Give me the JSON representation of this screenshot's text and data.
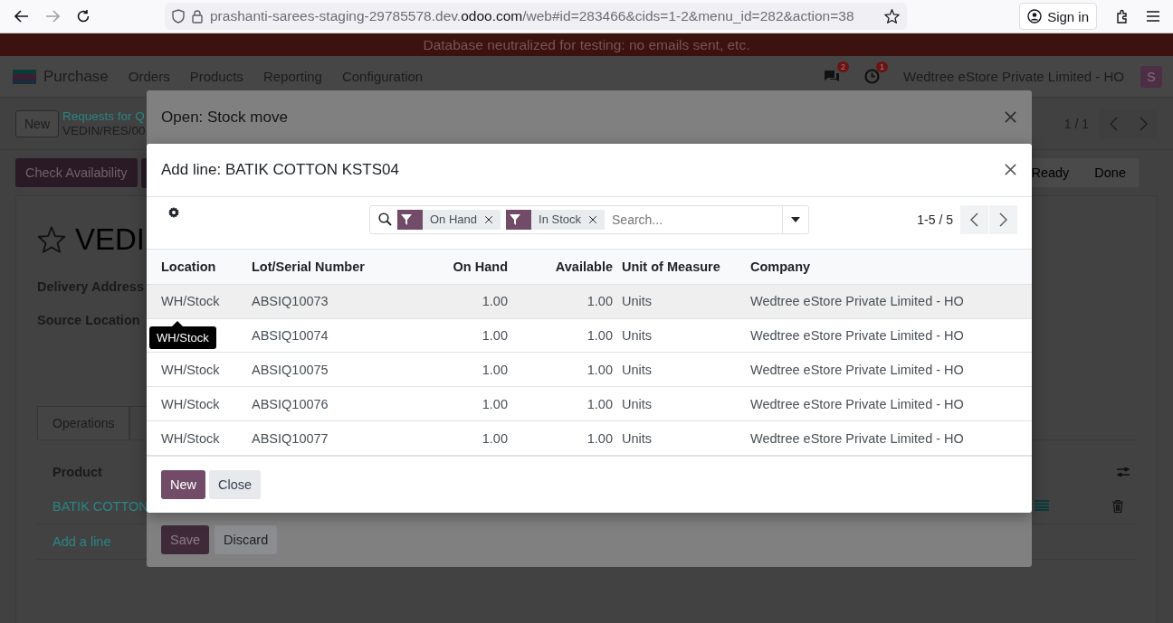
{
  "browser": {
    "url_prefix": "prashanti-sarees-staging-29785578.dev.",
    "url_domain": "odoo.com",
    "url_path": "/web#id=283466&cids=1-2&menu_id=282&action=38",
    "sign_in": "Sign in"
  },
  "banner": "Database neutralized for testing: no emails sent, etc.",
  "navbar": {
    "app": "Purchase",
    "menu": [
      "Orders",
      "Products",
      "Reporting",
      "Configuration"
    ],
    "messages_badge": "2",
    "activities_badge": "1",
    "company": "Wedtree eStore Private Limited - HO",
    "avatar": "S"
  },
  "control_panel": {
    "new": "New",
    "breadcrumb": "Requests for Q",
    "record": "VEDIN/RES/00",
    "pager": "1 / 1"
  },
  "statusbar": {
    "button": "Check Availability",
    "steps": [
      "Ready",
      "Done"
    ]
  },
  "form": {
    "title": "VEDI",
    "fields": [
      "Delivery Address",
      "Source Location"
    ],
    "tabs": [
      {
        "label": "Operations",
        "selected": true
      }
    ],
    "product_header": "Product",
    "line": "BATIK COTTON",
    "add_line": "Add a line"
  },
  "dialog_back": {
    "title": "Open: Stock move",
    "buttons": [
      {
        "label": "Save",
        "kind": "primary"
      },
      {
        "label": "Discard",
        "kind": "secondary"
      }
    ]
  },
  "dialog": {
    "title": "Add line: BATIK COTTON KSTS04",
    "facets": [
      "On Hand",
      "In Stock"
    ],
    "search_placeholder": "Search...",
    "pager": "1-5 / 5",
    "columns": [
      {
        "label": "Location",
        "numeric": false
      },
      {
        "label": "Lot/Serial Number",
        "numeric": false
      },
      {
        "label": "On Hand",
        "numeric": true
      },
      {
        "label": "Available",
        "numeric": true
      },
      {
        "label": "Unit of Measure",
        "numeric": false
      },
      {
        "label": "Company",
        "numeric": false
      }
    ],
    "rows": [
      {
        "highlighted": true,
        "cells": [
          "WH/Stock",
          "ABSIQ10073",
          "1.00",
          "1.00",
          "Units",
          "Wedtree eStore Private Limited - HO"
        ]
      },
      {
        "highlighted": false,
        "tooltip": "WH/Stock",
        "cells": [
          "",
          "ABSIQ10074",
          "1.00",
          "1.00",
          "Units",
          "Wedtree eStore Private Limited - HO"
        ]
      },
      {
        "highlighted": false,
        "cells": [
          "WH/Stock",
          "ABSIQ10075",
          "1.00",
          "1.00",
          "Units",
          "Wedtree eStore Private Limited - HO"
        ]
      },
      {
        "highlighted": false,
        "cells": [
          "WH/Stock",
          "ABSIQ10076",
          "1.00",
          "1.00",
          "Units",
          "Wedtree eStore Private Limited - HO"
        ]
      },
      {
        "highlighted": false,
        "cells": [
          "WH/Stock",
          "ABSIQ10077",
          "1.00",
          "1.00",
          "Units",
          "Wedtree eStore Private Limited - HO"
        ]
      }
    ],
    "buttons": [
      {
        "label": "New",
        "kind": "primary"
      },
      {
        "label": "Close",
        "kind": "secondary"
      }
    ]
  }
}
